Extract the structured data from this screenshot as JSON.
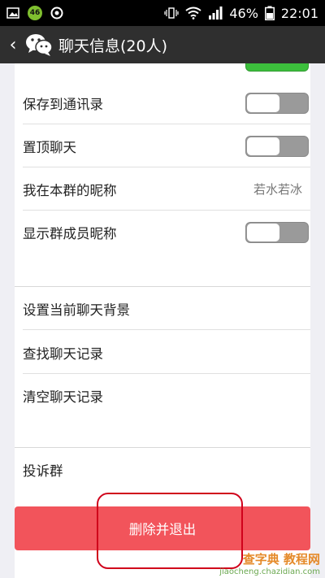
{
  "status_bar": {
    "network_badge": "46",
    "battery": "46%",
    "time": "22:01"
  },
  "header": {
    "back_glyph": "‹",
    "title": "聊天信息(20人)"
  },
  "settings": {
    "group1": [
      {
        "label": "保存到通讯录",
        "toggle": "off"
      },
      {
        "label": "置顶聊天",
        "toggle": "off"
      },
      {
        "label": "我在本群的昵称",
        "value": "若水若冰"
      },
      {
        "label": "显示群成员昵称",
        "toggle": "off"
      }
    ],
    "group2": [
      {
        "label": "设置当前聊天背景"
      },
      {
        "label": "查找聊天记录"
      },
      {
        "label": "清空聊天记录"
      }
    ],
    "group3": [
      {
        "label": "投诉群"
      }
    ]
  },
  "delete_button": {
    "label": "删除并退出"
  },
  "colors": {
    "delete_button": "#f2545b",
    "title_bar": "#2f2f2f",
    "annotation": "#d0021b",
    "toggle_on": "#3cbf3c"
  },
  "watermark": {
    "main": "查字典 教程网",
    "sub": "jiaocheng.chazidian.com"
  }
}
